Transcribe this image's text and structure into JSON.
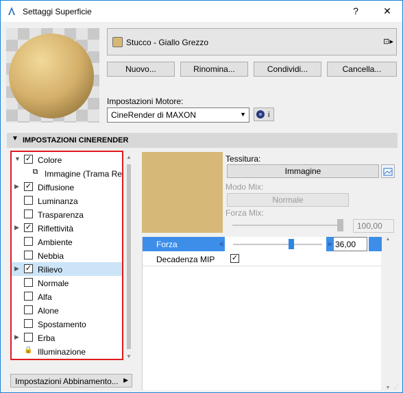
{
  "window": {
    "title": "Settaggi Superficie",
    "help": "?",
    "close": "✕"
  },
  "material": {
    "name": "Stucco - Giallo Grezzo",
    "swatch_color": "#d8b870"
  },
  "buttons": {
    "new": "Nuovo...",
    "rename": "Rinomina...",
    "share": "Condividi...",
    "delete": "Cancella..."
  },
  "engine": {
    "label": "Impostazioni Motore:",
    "value": "CineRender di MAXON",
    "info": "i"
  },
  "section": {
    "title": "IMPOSTAZIONI CINERENDER"
  },
  "channels": [
    {
      "label": "Colore",
      "expander": "open",
      "checked": true
    },
    {
      "label": "Immagine (Trama Resa",
      "expander": "none",
      "checked": null,
      "sub": true
    },
    {
      "label": "Diffusione",
      "expander": "closed",
      "checked": true
    },
    {
      "label": "Luminanza",
      "expander": "none",
      "checked": false
    },
    {
      "label": "Trasparenza",
      "expander": "none",
      "checked": false
    },
    {
      "label": "Riflettività",
      "expander": "closed",
      "checked": true
    },
    {
      "label": "Ambiente",
      "expander": "none",
      "checked": false
    },
    {
      "label": "Nebbia",
      "expander": "none",
      "checked": false
    },
    {
      "label": "Rilievo",
      "expander": "closed",
      "checked": true,
      "selected": true
    },
    {
      "label": "Normale",
      "expander": "none",
      "checked": false
    },
    {
      "label": "Alfa",
      "expander": "none",
      "checked": false
    },
    {
      "label": "Alone",
      "expander": "none",
      "checked": false
    },
    {
      "label": "Spostamento",
      "expander": "none",
      "checked": false
    },
    {
      "label": "Erba",
      "expander": "closed",
      "checked": false
    },
    {
      "label": "Illuminazione",
      "expander": "none",
      "checked": null,
      "lock": true
    }
  ],
  "matching_button": "Impostazioni Abbinamento...",
  "texture": {
    "label": "Tessitura:",
    "button": "Immagine",
    "color": "#d9b977"
  },
  "mix": {
    "mode_label": "Modo Mix:",
    "mode_value": "Normale",
    "strength_label": "Forza Mix:",
    "strength_value": "100,00",
    "strength_level": 1.0
  },
  "params": [
    {
      "name": "Forza",
      "value": "36,00",
      "level": 0.36
    },
    {
      "name": "Decadenza MIP",
      "checked": true
    }
  ]
}
